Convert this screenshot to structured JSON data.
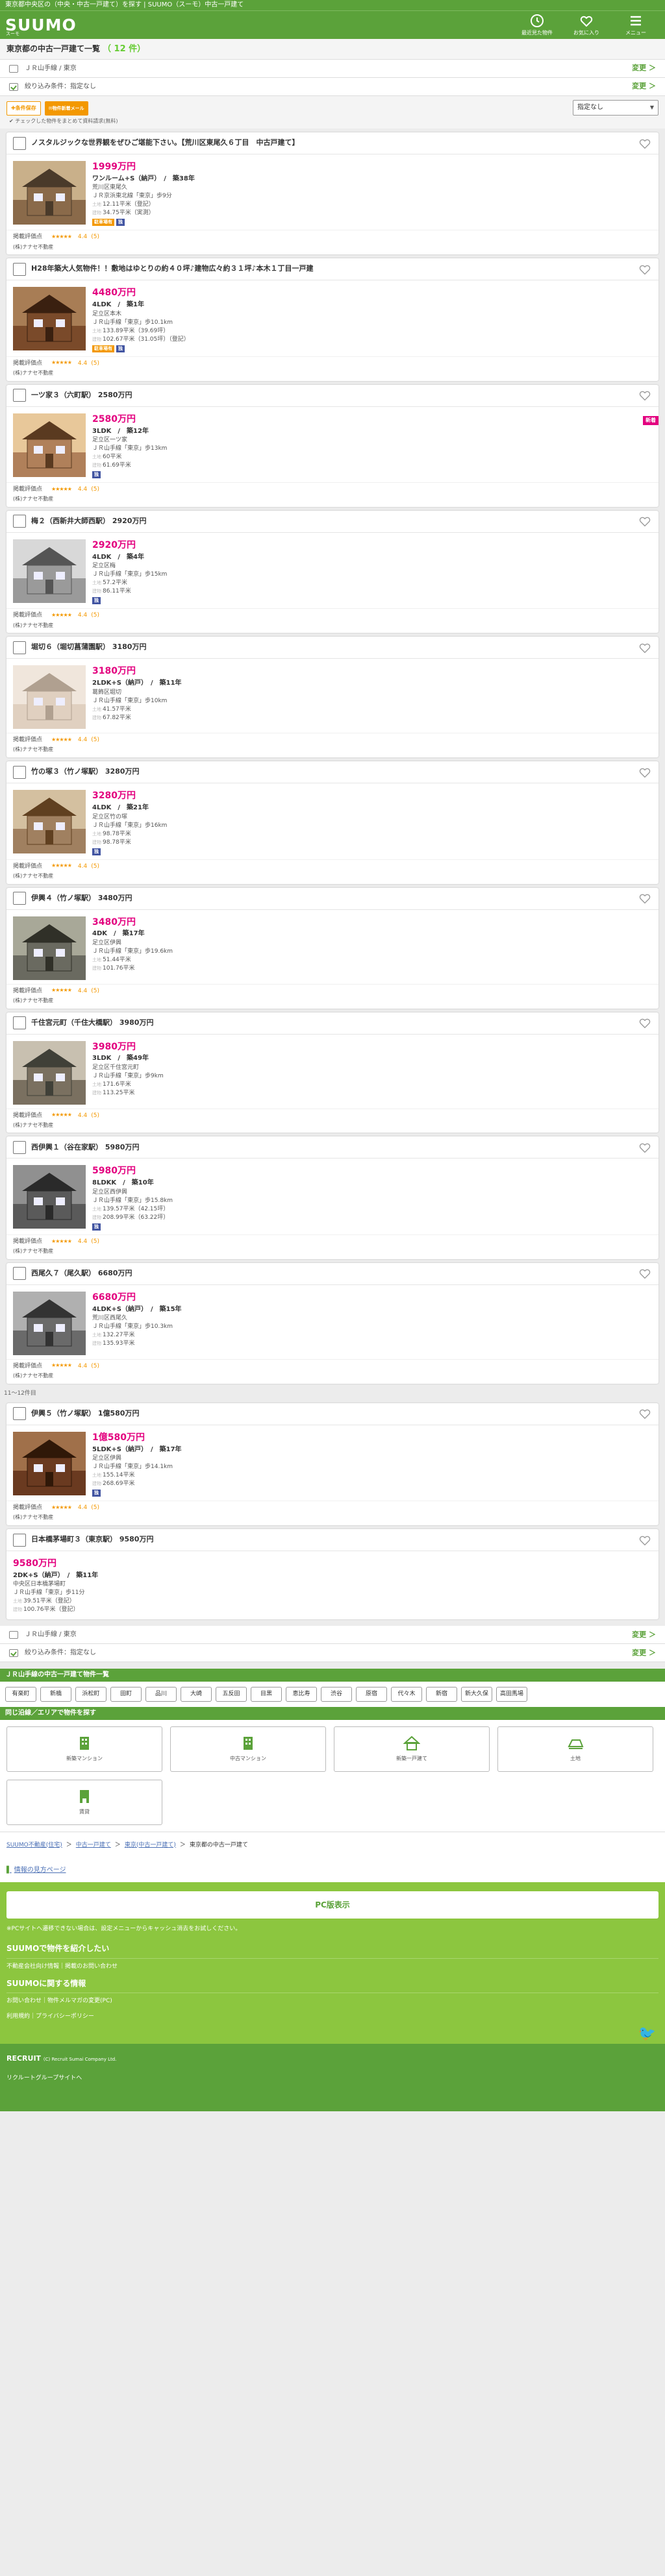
{
  "topbar": {
    "text": "東京都中央区の（中央・中古一戸建て）を探す | SUUMO（スーモ）中古一戸建て"
  },
  "header": {
    "logo": "SUUMO",
    "logo_sub": "スーモ",
    "icons": [
      {
        "name": "history-icon",
        "label": "最近見た物件"
      },
      {
        "name": "favorite-icon",
        "label": "お気に入り"
      },
      {
        "name": "menu-icon",
        "label": "メニュー"
      }
    ]
  },
  "title": {
    "text": "東京都の中古一戸建て一覧",
    "count": "（ 12 件）"
  },
  "conditions": [
    {
      "label": "ＪＲ山手線 / 東京",
      "change": "変更 ＞"
    },
    {
      "label": "絞り込み条件：指定なし",
      "change": "変更 ＞"
    }
  ],
  "toolbar": {
    "save_label": "条件保存",
    "mail_label": "物件新着メール",
    "note": "チェックした物件をまとめて資料請求(無料)",
    "sort_label": "指定なし"
  },
  "cards": [
    {
      "title": "ノスタルジックな世界観をぜひご堪能下さい。【荒川区東尾久６丁目　中古戸建て】",
      "price": "1999万円",
      "layout": "ワンルーム+S（納戸）　/　築38年",
      "addr": "荒川区東尾久",
      "station": "ＪＲ京浜東北線「東京」歩9分",
      "land": "12.11平米（登記）",
      "bldg": "34.75平米（実測）",
      "tags": [
        "駐車場有",
        "独"
      ],
      "rating": "4.4",
      "count": "(5)",
      "agent": "(株)ナナセ不動産",
      "photo": "house1"
    },
    {
      "title": "H28年築大人気物件！！敷地はゆとりの約４０坪♪建物広々約３１坪♪本木１丁目一戸建",
      "price": "4480万円",
      "layout": "4LDK　/　築1年",
      "addr": "足立区本木",
      "station": "ＪＲ山手線「東京」歩10.1km",
      "land": "133.89平米（39.69坪）",
      "bldg": "102.67平米（31.05坪）（登記）",
      "tags": [
        "駐車場有",
        "独"
      ],
      "rating": "4.4",
      "count": "(5)",
      "agent": "(株)ナナセ不動産",
      "photo": "house2"
    },
    {
      "title": "一ツ家３（六町駅） 2580万円",
      "price": "2580万円",
      "layout": "3LDK　/　築12年",
      "addr": "足立区一ツ家",
      "station": "ＪＲ山手線「東京」歩13km",
      "land": "60平米",
      "bldg": "61.69平米",
      "tags": [
        "独"
      ],
      "rating": "4.4",
      "count": "(5)",
      "agent": "(株)ナナセ不動産",
      "photo": "house3",
      "badge": "新着"
    },
    {
      "title": "梅２（西新井大師西駅） 2920万円",
      "price": "2920万円",
      "layout": "4LDK　/　築4年",
      "addr": "足立区梅",
      "station": "ＪＲ山手線「東京」歩15km",
      "land": "57.2平米",
      "bldg": "86.11平米",
      "tags": [
        "独"
      ],
      "rating": "4.4",
      "count": "(5)",
      "agent": "(株)ナナセ不動産",
      "photo": "house4"
    },
    {
      "title": "堀切６（堀切菖蒲園駅） 3180万円",
      "price": "3180万円",
      "layout": "2LDK+S（納戸）　/　築11年",
      "addr": "葛飾区堀切",
      "station": "ＪＲ山手線「東京」歩10km",
      "land": "41.57平米",
      "bldg": "67.82平米",
      "tags": [],
      "rating": "4.4",
      "count": "(5)",
      "agent": "(株)ナナセ不動産",
      "photo": "house5"
    },
    {
      "title": "竹の塚３（竹ノ塚駅） 3280万円",
      "price": "3280万円",
      "layout": "4LDK　/　築21年",
      "addr": "足立区竹の塚",
      "station": "ＪＲ山手線「東京」歩16km",
      "land": "98.78平米",
      "bldg": "98.78平米",
      "tags": [
        "独"
      ],
      "rating": "4.4",
      "count": "(5)",
      "agent": "(株)ナナセ不動産",
      "photo": "house6"
    },
    {
      "title": "伊興４（竹ノ塚駅） 3480万円",
      "price": "3480万円",
      "layout": "4DK　/　築17年",
      "addr": "足立区伊興",
      "station": "ＪＲ山手線「東京」歩19.6km",
      "land": "51.44平米",
      "bldg": "101.76平米",
      "tags": [],
      "rating": "4.4",
      "count": "(5)",
      "agent": "(株)ナナセ不動産",
      "photo": "house7"
    },
    {
      "title": "千住宮元町（千住大橋駅） 3980万円",
      "price": "3980万円",
      "layout": "3LDK　/　築49年",
      "addr": "足立区千住宮元町",
      "station": "ＪＲ山手線「東京」歩9km",
      "land": "171.6平米",
      "bldg": "113.25平米",
      "tags": [],
      "rating": "4.4",
      "count": "(5)",
      "agent": "(株)ナナセ不動産",
      "photo": "house8"
    },
    {
      "title": "西伊興１（谷在家駅） 5980万円",
      "price": "5980万円",
      "layout": "8LDKK　/　築10年",
      "addr": "足立区西伊興",
      "station": "ＪＲ山手線「東京」歩15.8km",
      "land": "139.57平米（42.15坪）",
      "bldg": "208.99平米（63.22坪）",
      "tags": [
        "独"
      ],
      "rating": "4.4",
      "count": "(5)",
      "agent": "(株)ナナセ不動産",
      "photo": "house9"
    },
    {
      "title": "西尾久７（尾久駅） 6680万円",
      "price": "6680万円",
      "layout": "4LDK+S（納戸）　/　築15年",
      "addr": "荒川区西尾久",
      "station": "ＪＲ山手線「東京」歩10.3km",
      "land": "132.27平米",
      "bldg": "135.93平米",
      "tags": [],
      "rating": "4.4",
      "count": "(5)",
      "agent": "(株)ナナセ不動産",
      "photo": "house10"
    }
  ],
  "separator": "11～12件目",
  "cards2": [
    {
      "title": "伊興５（竹ノ塚駅） 1億580万円",
      "price": "1億580万円",
      "layout": "5LDK+S（納戸）　/　築17年",
      "addr": "足立区伊興",
      "station": "ＪＲ山手線「東京」歩14.1km",
      "land": "155.14平米",
      "bldg": "268.69平米",
      "tags": [
        "独"
      ],
      "rating": "4.4",
      "count": "(5)",
      "agent": "(株)ナナセ不動産",
      "photo": "house11"
    },
    {
      "title": "日本橋茅場町３（東京駅） 9580万円",
      "price": "9580万円",
      "layout": "2DK+S（納戸）　/　築11年",
      "addr": "中央区日本橋茅場町",
      "station": "ＪＲ山手線「東京」歩11分",
      "land": "39.51平米（登記）",
      "bldg": "100.76平米（登記）",
      "tags": [],
      "rating": "",
      "count": "",
      "agent": "",
      "photo": ""
    }
  ],
  "stations_head": "ＪＲ山手線の中古一戸建て物件一覧",
  "stations": [
    "有楽町",
    "新橋",
    "浜松町",
    "田町",
    "品川",
    "大崎",
    "五反田",
    "目黒",
    "恵比寿",
    "渋谷",
    "原宿",
    "代々木",
    "新宿",
    "新大久保",
    "高田馬場"
  ],
  "area_head": "同じ沿線／エリアで物件を探す",
  "categories": [
    {
      "name": "new-mansion-icon",
      "label": "新築マンション"
    },
    {
      "name": "used-mansion-icon",
      "label": "中古マンション"
    },
    {
      "name": "new-house-icon",
      "label": "新築一戸建て"
    },
    {
      "name": "land-icon",
      "label": "土地"
    },
    {
      "name": "rental-icon",
      "label": "賃貸"
    }
  ],
  "breadcrumbs": [
    "SUUMO不動産(住宅)",
    "＞",
    "中古一戸建て",
    "＞",
    "東京(中古一戸建て)",
    "＞",
    "東京都の中古一戸建て"
  ],
  "page_link": "情報の見方ページ",
  "pc_button": "PC版表示",
  "green_note": "※PCサイトへ遷移できない場合は、設定メニューからキャッシュ消去をお試しください。",
  "sec1_title": "SUUMOで物件を紹介したい",
  "sec1_link": "不動産会社向け情報｜掲載のお問い合わせ",
  "sec2_title": "SUUMOに関する情報",
  "sec2_link": "お問い合わせ｜物件メルマガの変更(PC)",
  "sec2_link2": "利用規約｜プライバシーポリシー",
  "footer_brand": "RECRUIT",
  "footer_copy": "(C) Recruit Sumai Company Ltd.",
  "footer_group": "リクルートグループサイトへ"
}
